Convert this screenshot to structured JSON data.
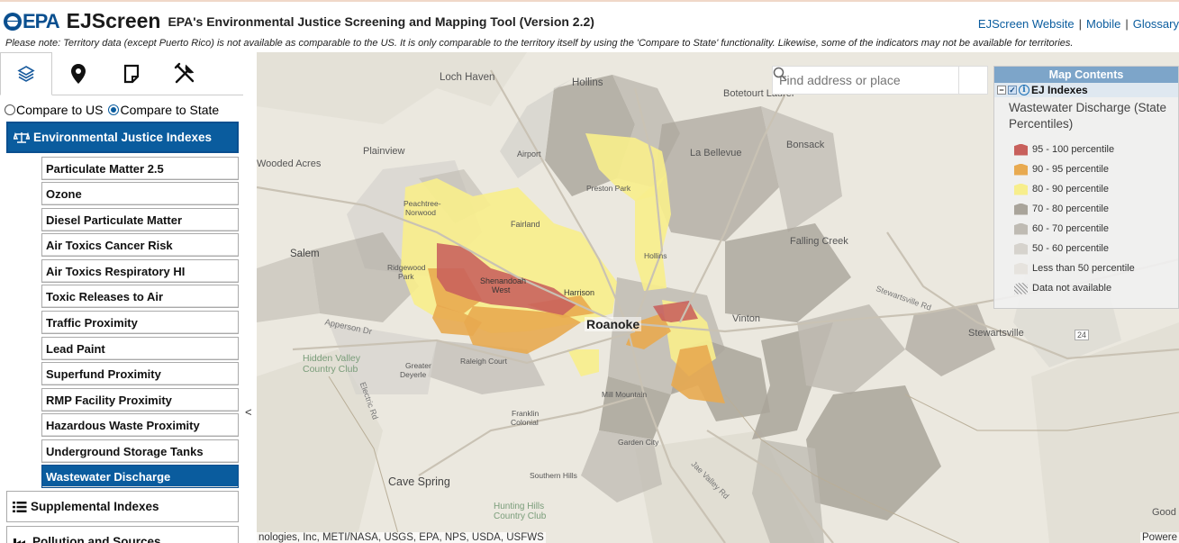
{
  "header": {
    "epa": "EPA",
    "app_name": "EJScreen",
    "subtitle": "EPA's Environmental Justice Screening and Mapping Tool (Version 2.2)",
    "links": [
      "EJScreen Website",
      "Mobile",
      "Glossary"
    ],
    "separator": "|"
  },
  "notice": "Please note: Territory data (except Puerto Rico) is not available as comparable to the US. It is only comparable to the territory itself by using the 'Compare to State' functionality. Likewise, some of the indicators may not be available for territories.",
  "tabs": [
    {
      "icon": "layers-icon",
      "active": true
    },
    {
      "icon": "map-pin-icon",
      "active": false
    },
    {
      "icon": "report-icon",
      "active": false
    },
    {
      "icon": "tools-icon",
      "active": false
    }
  ],
  "compare": {
    "us_label": "Compare to US",
    "state_label": "Compare to State",
    "selected": "Compare to State"
  },
  "categories": {
    "ej_indexes": "Environmental Justice Indexes",
    "supplemental": "Supplemental Indexes",
    "pollution": "Pollution and Sources"
  },
  "indicators": [
    "Particulate Matter 2.5",
    "Ozone",
    "Diesel Particulate Matter",
    "Air Toxics Cancer Risk",
    "Air Toxics Respiratory HI",
    "Toxic Releases to Air",
    "Traffic Proximity",
    "Lead Paint",
    "Superfund Proximity",
    "RMP Facility Proximity",
    "Hazardous Waste Proximity",
    "Underground Storage Tanks",
    "Wastewater Discharge"
  ],
  "selected_indicator": "Wastewater Discharge",
  "collapse_label": "<",
  "search": {
    "placeholder": "Find address or place"
  },
  "legend": {
    "header": "Map Contents",
    "layer": "EJ Indexes",
    "title_line1": "Wastewater Discharge (State",
    "title_line2": "Percentiles)",
    "items": [
      {
        "label": "95 - 100 percentile",
        "color": "#c8605c"
      },
      {
        "label": "90 - 95 percentile",
        "color": "#e8aa50"
      },
      {
        "label": "80 - 90 percentile",
        "color": "#f7ee8c"
      },
      {
        "label": "70 - 80 percentile",
        "color": "#a9a49a"
      },
      {
        "label": "60 - 70 percentile",
        "color": "#bfbbb3"
      },
      {
        "label": "50 - 60 percentile",
        "color": "#d6d3cd"
      },
      {
        "label": "Less than 50 percentile",
        "color": "#e6e3de"
      },
      {
        "label": "Data not available",
        "color": "hatch"
      }
    ]
  },
  "map_labels": {
    "loch_haven": "Loch Haven",
    "hollins": "Hollins",
    "botetourt": "Botetourt Laurel",
    "plainview": "Plainview",
    "airport": "Airport",
    "bonsack": "Bonsack",
    "woodedacres": "Wooded Acres",
    "labellevue": "La Bellevue",
    "prestonpark": "Preston Park",
    "peachtree1": "Peachtree-",
    "peachtree2": "Norwood",
    "fairland": "Fairland",
    "fallingcreek": "Falling Creek",
    "hollins2": "Hollins",
    "salem": "Salem",
    "ridgewood1": "Ridgewood",
    "ridgewood2": "Park",
    "shenandoah1": "Shenandoah",
    "shenandoah2": "West",
    "harrison": "Harrison",
    "stewartsvillerd": "Stewartsville Rd",
    "apperson": "Apperson Dr",
    "roanoke": "Roanoke",
    "vinton": "Vinton",
    "stewartsville": "Stewartsville",
    "hiddenvalley1": "Hidden Valley",
    "hiddenvalley2": "Country Club",
    "ralcigh": "Raleigh Court",
    "greater1": "Greater",
    "greater2": "Deyerle",
    "electricrd": "Electric Rd",
    "millmountain": "Mill Mountain",
    "franklin1": "Franklin",
    "franklin2": "Colonial",
    "gardencity": "Garden City",
    "southernhills": "Southern Hills",
    "cavespring": "Cave Spring",
    "hunting1": "Hunting Hills",
    "hunting2": "Country Club",
    "jaevalley": "Jae Valley Rd",
    "route24": "24",
    "good": "Good"
  },
  "attribution": "nologies, Inc, METI/NASA, USGS, EPA, NPS, USDA, USFWS",
  "powered": "Powere"
}
